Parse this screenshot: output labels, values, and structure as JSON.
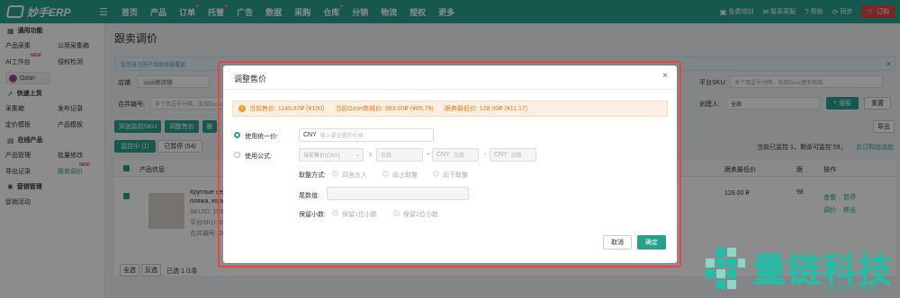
{
  "topbar": {
    "logo": "妙手ERP",
    "nav": [
      "首页",
      "产品",
      "订单",
      "托管",
      "广告",
      "数据",
      "采购",
      "仓库",
      "分销",
      "物流",
      "授权",
      "更多"
    ],
    "right": [
      "免费培训",
      "联系客服",
      "帮助",
      "同步"
    ],
    "order_btn": "订购"
  },
  "sidebar": {
    "sections": [
      {
        "title": "通用功能",
        "rows": [
          [
            "产品采集",
            "公用采集箱"
          ],
          [
            "AI工作台",
            "侵权检测"
          ]
        ]
      },
      {
        "title": "快速上货",
        "rows": [
          [
            "采集箱",
            "发布记录"
          ],
          [
            "定价模板",
            "产品模板"
          ]
        ]
      },
      {
        "title": "在线产品",
        "rows": [
          [
            "产品管理",
            "批量修改"
          ],
          [
            "导出记录",
            "跟卖调价"
          ]
        ]
      },
      {
        "title": "营销管理",
        "rows": [
          [
            "促销活动",
            ""
          ]
        ]
      }
    ],
    "platform_tab": "Ozon",
    "new_badge": "NEW"
  },
  "main": {
    "page_title": "跟卖调价",
    "info_text": "监控自己的产品跟卖被覆盖",
    "filters": {
      "store_label": "店铺",
      "store_value": "ozon新店铺",
      "merge_label": "合并编号:",
      "merge_placeholder": "多个用逗号分隔，支持Excel复制粘贴",
      "sku_label": "平台SKU:",
      "sku_placeholder": "多个用逗号分隔，支持Excel复制粘贴",
      "creator_label": "创建人:",
      "creator_value": "全部",
      "search": "搜索",
      "reset": "重置"
    },
    "actions": {
      "add_monitor": "添加监控SKU",
      "adjust": "调整售价",
      "third": "删",
      "export": "导出"
    },
    "tabs": {
      "monitoring": "监控中 (1)",
      "paused": "已暂停 (54)"
    },
    "summary": "当前已监控 1，剩余可监控 59，",
    "summary_link": "去订购加油包",
    "columns": {
      "info": "产品信息",
      "min_price": "跟卖最低价",
      "op": "操作",
      "trunc": "跟"
    },
    "row": {
      "title": "Круглые сер...",
      "title2": "пляжа, колы...",
      "skuid": "SKUID: 1567...",
      "platform_sku": "平台SKU: 26...",
      "merge": "合并编号: 26...",
      "min_price": "128.00 ₽",
      "trunc_price": "98",
      "ops": [
        "查看",
        "暂停",
        "调价",
        "移出"
      ]
    },
    "footer": {
      "select_all": "全选",
      "invert": "反选",
      "selected": "已选 1 /1条"
    }
  },
  "dialog": {
    "title": "调整售价",
    "prices": [
      "当前售价: 1145.87₽ (¥100)",
      "当前Ozon商城价: 983.00₽ (¥85.79)",
      "跟卖最低价: 128.00₽ (¥11.17)"
    ],
    "unified_label": "使用统一价:",
    "unified_currency": "CNY",
    "unified_placeholder": "输入要设置的价格",
    "formula_label": "使用公式:",
    "formula_select": "当前售价(CNY)",
    "times": "x",
    "factor_placeholder": "倍数",
    "plus": "+",
    "add_currency": "CNY",
    "add_placeholder": "加数",
    "minus": "-",
    "sub_currency": "CNY",
    "sub_placeholder": "减数",
    "rounding_label": "取整方式:",
    "rounding_options": [
      "四舍五入",
      "向上取整",
      "向下取整"
    ],
    "tail_label": "尾数值:",
    "decimals_label": "保留小数:",
    "decimals_options": [
      "保留1位小数",
      "保留2位小数"
    ],
    "cancel": "取消",
    "confirm": "确定"
  },
  "watermark": {
    "text": "量链科技",
    "sub": "QFSP.NET"
  },
  "colors": {
    "brand": "#28a08c",
    "warn": "#e87c1e",
    "danger": "#e04747"
  }
}
